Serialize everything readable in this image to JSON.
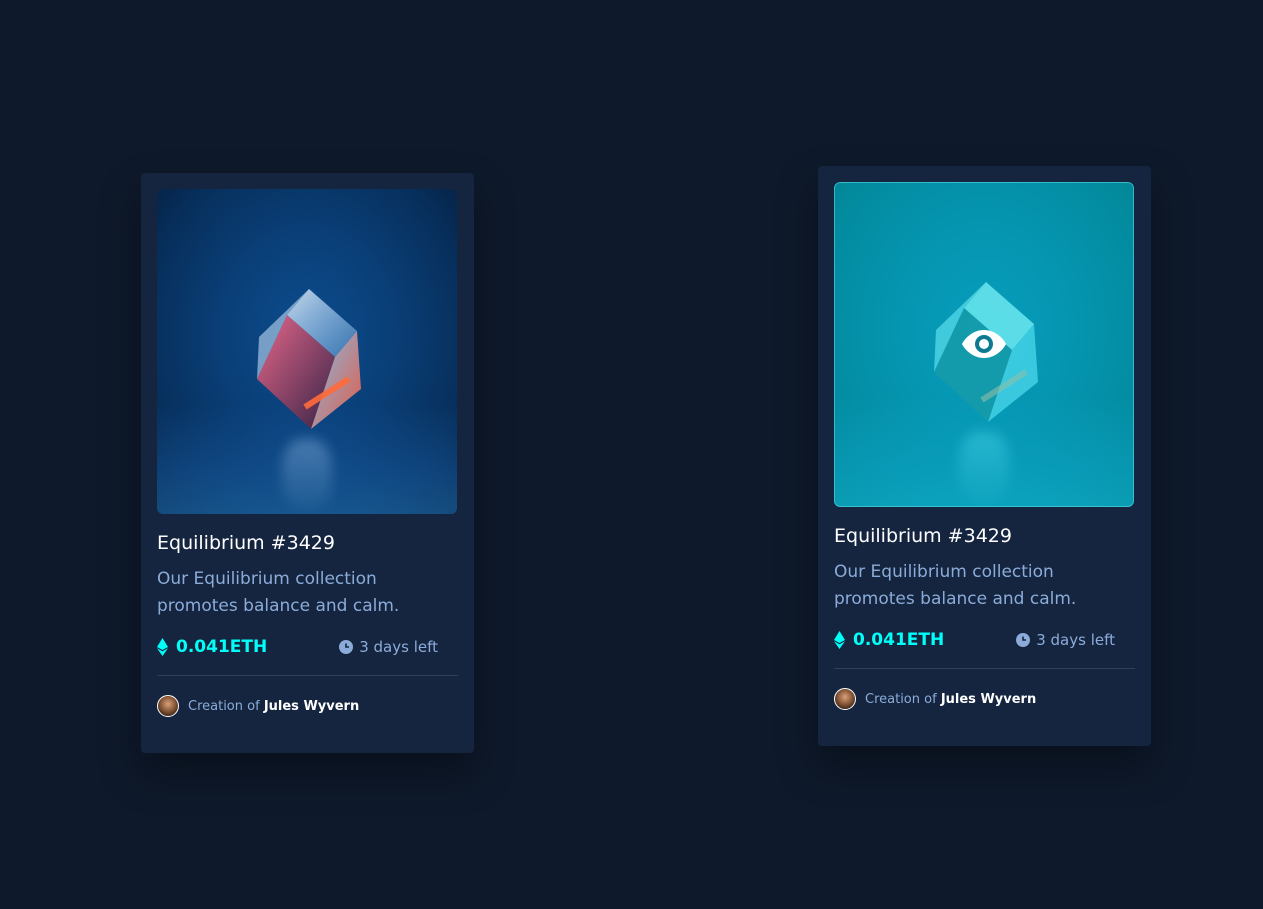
{
  "cards": [
    {
      "state": "default",
      "title": "Equilibrium #3429",
      "description": "Our Equilibrium collection promotes balance and calm.",
      "price": "0.041ETH",
      "time_left": "3 days left",
      "creator_prefix": "Creation of",
      "creator_name": "Jules Wyvern",
      "icons": [
        "ethereum-icon",
        "clock-icon"
      ]
    },
    {
      "state": "hover",
      "title": "Equilibrium #3429",
      "description": "Our Equilibrium collection promotes balance and calm.",
      "price": "0.041ETH",
      "time_left": "3 days left",
      "creator_prefix": "Creation of",
      "creator_name": "Jules Wyvern",
      "icons": [
        "ethereum-icon",
        "clock-icon",
        "view-eye-icon"
      ]
    }
  ],
  "colors": {
    "page_background": "#0e192b",
    "card_background": "#15253f",
    "accent_cyan": "#00fff8",
    "soft_blue": "#8bacd9",
    "white": "#ffffff",
    "divider": "#2e405a"
  }
}
